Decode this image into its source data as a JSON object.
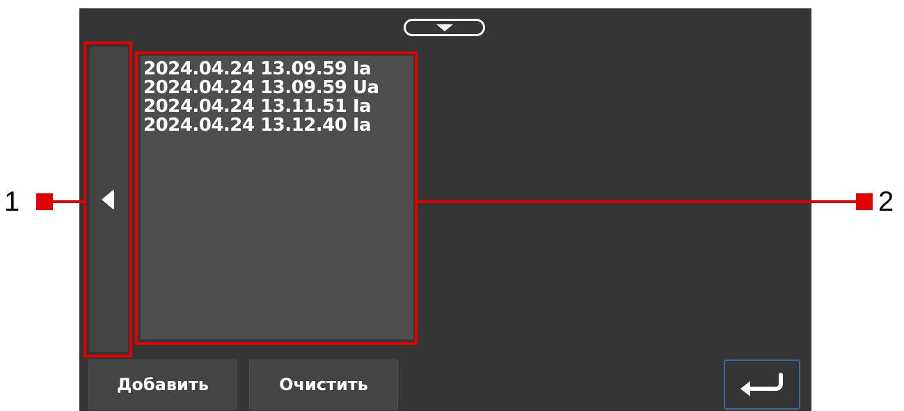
{
  "colors": {
    "screen_bg": "#353535",
    "panel_bg": "#444444",
    "list_bg": "#4e4e4e",
    "callout_red": "#e00000",
    "enter_border": "#3d6c9a"
  },
  "top_toggle": {
    "icon": "chevron-down-icon"
  },
  "side_panel": {
    "icon": "triangle-left-icon"
  },
  "list": {
    "items": [
      "2024.04.24 13.09.59 Ia",
      "2024.04.24 13.09.59 Ua",
      "2024.04.24 13.11.51 Ia",
      "2024.04.24 13.12.40 Ia"
    ]
  },
  "buttons": {
    "add_label": "Добавить",
    "clear_label": "Очистить",
    "enter_icon": "enter-return-icon"
  },
  "callouts": {
    "left_number": "1",
    "right_number": "2"
  }
}
